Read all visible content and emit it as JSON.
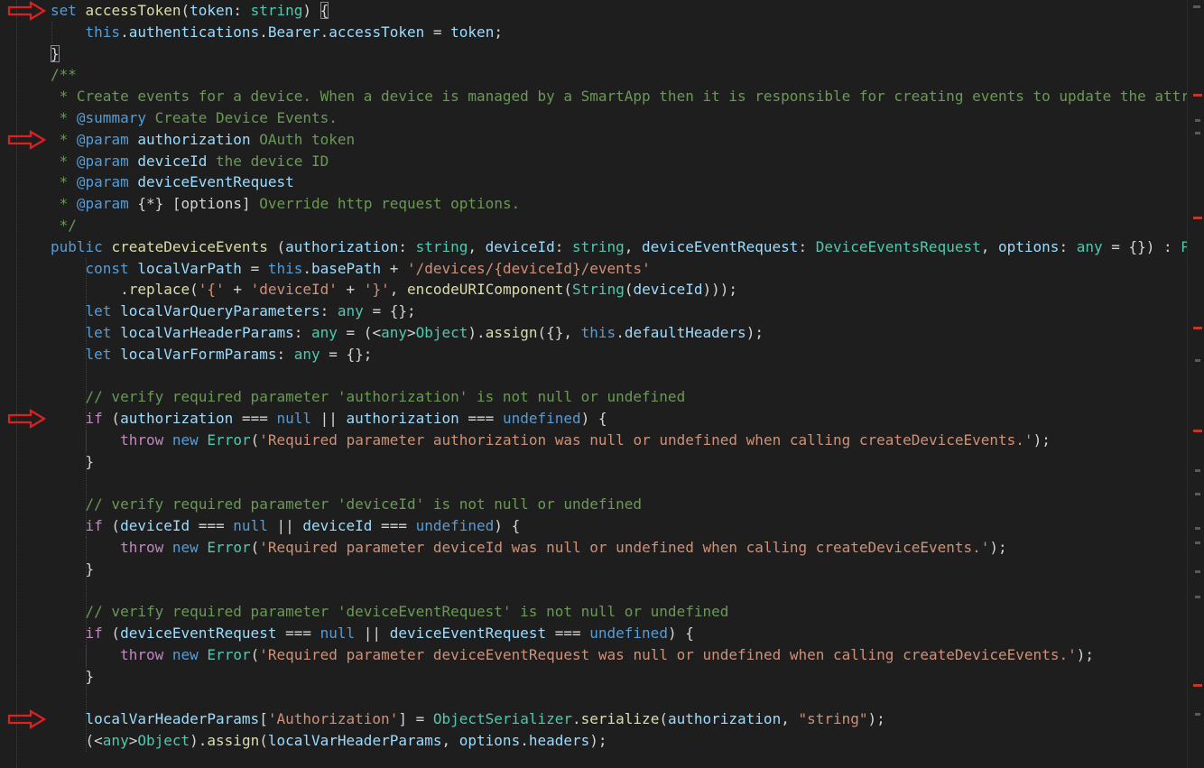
{
  "editor": {
    "lines": [
      {
        "y": 0,
        "arrow": true,
        "tokens": [
          [
            "set",
            "kw"
          ],
          [
            " ",
            "pl"
          ],
          [
            "accessToken",
            "fn"
          ],
          [
            "(",
            "pn"
          ],
          [
            "token",
            "vr"
          ],
          [
            ": ",
            "pn"
          ],
          [
            "string",
            "ty"
          ],
          [
            ") ",
            "pn"
          ],
          [
            "{",
            "bh"
          ]
        ]
      },
      {
        "y": 1,
        "tokens": [
          [
            "    ",
            "pl"
          ],
          [
            "this",
            "kw"
          ],
          [
            ".",
            "pn"
          ],
          [
            "authentications",
            "vr"
          ],
          [
            ".",
            "pn"
          ],
          [
            "Bearer",
            "vr"
          ],
          [
            ".",
            "pn"
          ],
          [
            "accessToken",
            "vr"
          ],
          [
            " = ",
            "pn"
          ],
          [
            "token",
            "vr"
          ],
          [
            ";",
            "pn"
          ]
        ]
      },
      {
        "y": 2,
        "tokens": [
          [
            "}",
            "bh"
          ]
        ]
      },
      {
        "y": 3,
        "tokens": [
          [
            "/**",
            "cm"
          ]
        ]
      },
      {
        "y": 4,
        "tokens": [
          [
            " * Create events for a device. When a device is managed by a SmartApp then it is responsible for creating events to update the attr",
            "cm"
          ]
        ]
      },
      {
        "y": 5,
        "tokens": [
          [
            " * ",
            "cm"
          ],
          [
            "@summary",
            "tg"
          ],
          [
            " Create Device Events.",
            "cm"
          ]
        ]
      },
      {
        "y": 6,
        "arrow": true,
        "tokens": [
          [
            " * ",
            "cm"
          ],
          [
            "@param",
            "tg"
          ],
          [
            " ",
            "cm"
          ],
          [
            "authorization",
            "vr"
          ],
          [
            " OAuth token",
            "cm"
          ]
        ]
      },
      {
        "y": 7,
        "tokens": [
          [
            " * ",
            "cm"
          ],
          [
            "@param",
            "tg"
          ],
          [
            " ",
            "cm"
          ],
          [
            "deviceId",
            "vr"
          ],
          [
            " the device ID",
            "cm"
          ]
        ]
      },
      {
        "y": 8,
        "tokens": [
          [
            " * ",
            "cm"
          ],
          [
            "@param",
            "tg"
          ],
          [
            " ",
            "cm"
          ],
          [
            "deviceEventRequest",
            "vr"
          ]
        ]
      },
      {
        "y": 9,
        "tokens": [
          [
            " * ",
            "cm"
          ],
          [
            "@param",
            "tg"
          ],
          [
            " ",
            "cm"
          ],
          [
            "{*}",
            "pl"
          ],
          [
            " ",
            "cm"
          ],
          [
            "[options]",
            "pl"
          ],
          [
            " Override http request options.",
            "cm"
          ]
        ]
      },
      {
        "y": 10,
        "tokens": [
          [
            " */",
            "cm"
          ]
        ]
      },
      {
        "y": 11,
        "tokens": [
          [
            "public",
            "kw"
          ],
          [
            " ",
            "pl"
          ],
          [
            "createDeviceEvents",
            "fn"
          ],
          [
            " (",
            "pn"
          ],
          [
            "authorization",
            "vr"
          ],
          [
            ": ",
            "pn"
          ],
          [
            "string",
            "ty"
          ],
          [
            ", ",
            "pn"
          ],
          [
            "deviceId",
            "vr"
          ],
          [
            ": ",
            "pn"
          ],
          [
            "string",
            "ty"
          ],
          [
            ", ",
            "pn"
          ],
          [
            "deviceEventRequest",
            "vr"
          ],
          [
            ": ",
            "pn"
          ],
          [
            "DeviceEventsRequest",
            "ty"
          ],
          [
            ", ",
            "pn"
          ],
          [
            "options",
            "vr"
          ],
          [
            ": ",
            "pn"
          ],
          [
            "any",
            "ty"
          ],
          [
            " = {}) : ",
            "pn"
          ],
          [
            "Pr",
            "ty"
          ]
        ]
      },
      {
        "y": 12,
        "tokens": [
          [
            "    ",
            "pl"
          ],
          [
            "const",
            "kw"
          ],
          [
            " ",
            "pl"
          ],
          [
            "localVarPath",
            "vr"
          ],
          [
            " = ",
            "pn"
          ],
          [
            "this",
            "kw"
          ],
          [
            ".",
            "pn"
          ],
          [
            "basePath",
            "vr"
          ],
          [
            " + ",
            "pn"
          ],
          [
            "'/devices/{deviceId}/events'",
            "str"
          ]
        ]
      },
      {
        "y": 13,
        "tokens": [
          [
            "        .",
            "pn"
          ],
          [
            "replace",
            "fn"
          ],
          [
            "(",
            "pn"
          ],
          [
            "'{'",
            "str"
          ],
          [
            " + ",
            "pn"
          ],
          [
            "'deviceId'",
            "str"
          ],
          [
            " + ",
            "pn"
          ],
          [
            "'}'",
            "str"
          ],
          [
            ", ",
            "pn"
          ],
          [
            "encodeURIComponent",
            "fn"
          ],
          [
            "(",
            "pn"
          ],
          [
            "String",
            "ty"
          ],
          [
            "(",
            "pn"
          ],
          [
            "deviceId",
            "vr"
          ],
          [
            ")));",
            "pn"
          ]
        ]
      },
      {
        "y": 14,
        "tokens": [
          [
            "    ",
            "pl"
          ],
          [
            "let",
            "kw"
          ],
          [
            " ",
            "pl"
          ],
          [
            "localVarQueryParameters",
            "vr"
          ],
          [
            ": ",
            "pn"
          ],
          [
            "any",
            "ty"
          ],
          [
            " = {};",
            "pn"
          ]
        ]
      },
      {
        "y": 15,
        "tokens": [
          [
            "    ",
            "pl"
          ],
          [
            "let",
            "kw"
          ],
          [
            " ",
            "pl"
          ],
          [
            "localVarHeaderParams",
            "vr"
          ],
          [
            ": ",
            "pn"
          ],
          [
            "any",
            "ty"
          ],
          [
            " = (<",
            "pn"
          ],
          [
            "any",
            "ty"
          ],
          [
            ">",
            "pn"
          ],
          [
            "Object",
            "ty"
          ],
          [
            ").",
            "pn"
          ],
          [
            "assign",
            "fn"
          ],
          [
            "({}, ",
            "pn"
          ],
          [
            "this",
            "kw"
          ],
          [
            ".",
            "pn"
          ],
          [
            "defaultHeaders",
            "vr"
          ],
          [
            ");",
            "pn"
          ]
        ]
      },
      {
        "y": 16,
        "tokens": [
          [
            "    ",
            "pl"
          ],
          [
            "let",
            "kw"
          ],
          [
            " ",
            "pl"
          ],
          [
            "localVarFormParams",
            "vr"
          ],
          [
            ": ",
            "pn"
          ],
          [
            "any",
            "ty"
          ],
          [
            " = {};",
            "pn"
          ]
        ]
      },
      {
        "y": 18,
        "tokens": [
          [
            "    ",
            "pl"
          ],
          [
            "// verify required parameter 'authorization' is not null or undefined",
            "cm"
          ]
        ]
      },
      {
        "y": 19,
        "arrow": true,
        "tokens": [
          [
            "    ",
            "pl"
          ],
          [
            "if",
            "ctl"
          ],
          [
            " (",
            "pn"
          ],
          [
            "authorization",
            "vr"
          ],
          [
            " === ",
            "pn"
          ],
          [
            "null",
            "kw"
          ],
          [
            " || ",
            "pn"
          ],
          [
            "authorization",
            "vr"
          ],
          [
            " === ",
            "pn"
          ],
          [
            "undefined",
            "kw"
          ],
          [
            ") {",
            "pn"
          ]
        ]
      },
      {
        "y": 20,
        "tokens": [
          [
            "        ",
            "pl"
          ],
          [
            "throw",
            "ctl"
          ],
          [
            " ",
            "pl"
          ],
          [
            "new",
            "kw"
          ],
          [
            " ",
            "pl"
          ],
          [
            "Error",
            "ty"
          ],
          [
            "(",
            "pn"
          ],
          [
            "'Required parameter authorization was null or undefined when calling createDeviceEvents.'",
            "str"
          ],
          [
            ");",
            "pn"
          ]
        ]
      },
      {
        "y": 21,
        "tokens": [
          [
            "    }",
            "pn"
          ]
        ]
      },
      {
        "y": 23,
        "tokens": [
          [
            "    ",
            "pl"
          ],
          [
            "// verify required parameter 'deviceId' is not null or undefined",
            "cm"
          ]
        ]
      },
      {
        "y": 24,
        "tokens": [
          [
            "    ",
            "pl"
          ],
          [
            "if",
            "ctl"
          ],
          [
            " (",
            "pn"
          ],
          [
            "deviceId",
            "vr"
          ],
          [
            " === ",
            "pn"
          ],
          [
            "null",
            "kw"
          ],
          [
            " || ",
            "pn"
          ],
          [
            "deviceId",
            "vr"
          ],
          [
            " === ",
            "pn"
          ],
          [
            "undefined",
            "kw"
          ],
          [
            ") {",
            "pn"
          ]
        ]
      },
      {
        "y": 25,
        "tokens": [
          [
            "        ",
            "pl"
          ],
          [
            "throw",
            "ctl"
          ],
          [
            " ",
            "pl"
          ],
          [
            "new",
            "kw"
          ],
          [
            " ",
            "pl"
          ],
          [
            "Error",
            "ty"
          ],
          [
            "(",
            "pn"
          ],
          [
            "'Required parameter deviceId was null or undefined when calling createDeviceEvents.'",
            "str"
          ],
          [
            ");",
            "pn"
          ]
        ]
      },
      {
        "y": 26,
        "tokens": [
          [
            "    }",
            "pn"
          ]
        ]
      },
      {
        "y": 28,
        "tokens": [
          [
            "    ",
            "pl"
          ],
          [
            "// verify required parameter 'deviceEventRequest' is not null or undefined",
            "cm"
          ]
        ]
      },
      {
        "y": 29,
        "tokens": [
          [
            "    ",
            "pl"
          ],
          [
            "if",
            "ctl"
          ],
          [
            " (",
            "pn"
          ],
          [
            "deviceEventRequest",
            "vr"
          ],
          [
            " === ",
            "pn"
          ],
          [
            "null",
            "kw"
          ],
          [
            " || ",
            "pn"
          ],
          [
            "deviceEventRequest",
            "vr"
          ],
          [
            " === ",
            "pn"
          ],
          [
            "undefined",
            "kw"
          ],
          [
            ") {",
            "pn"
          ]
        ]
      },
      {
        "y": 30,
        "tokens": [
          [
            "        ",
            "pl"
          ],
          [
            "throw",
            "ctl"
          ],
          [
            " ",
            "pl"
          ],
          [
            "new",
            "kw"
          ],
          [
            " ",
            "pl"
          ],
          [
            "Error",
            "ty"
          ],
          [
            "(",
            "pn"
          ],
          [
            "'Required parameter deviceEventRequest was null or undefined when calling createDeviceEvents.'",
            "str"
          ],
          [
            ");",
            "pn"
          ]
        ]
      },
      {
        "y": 31,
        "tokens": [
          [
            "    }",
            "pn"
          ]
        ]
      },
      {
        "y": 33,
        "arrow": true,
        "tokens": [
          [
            "    ",
            "pl"
          ],
          [
            "localVarHeaderParams",
            "vr"
          ],
          [
            "[",
            "pn"
          ],
          [
            "'Authorization'",
            "str"
          ],
          [
            "] = ",
            "pn"
          ],
          [
            "ObjectSerializer",
            "ty"
          ],
          [
            ".",
            "pn"
          ],
          [
            "serialize",
            "fn"
          ],
          [
            "(",
            "pn"
          ],
          [
            "authorization",
            "vr"
          ],
          [
            ", ",
            "pn"
          ],
          [
            "\"string\"",
            "str"
          ],
          [
            ");",
            "pn"
          ]
        ]
      },
      {
        "y": 34,
        "tokens": [
          [
            "    (<",
            "pn"
          ],
          [
            "any",
            "ty"
          ],
          [
            ">",
            "pn"
          ],
          [
            "Object",
            "ty"
          ],
          [
            ").",
            "pn"
          ],
          [
            "assign",
            "fn"
          ],
          [
            "(",
            "pn"
          ],
          [
            "localVarHeaderParams",
            "vr"
          ],
          [
            ", ",
            "pn"
          ],
          [
            "options",
            "vr"
          ],
          [
            ".",
            "pn"
          ],
          [
            "headers",
            "vr"
          ],
          [
            ");",
            "pn"
          ]
        ]
      }
    ]
  }
}
